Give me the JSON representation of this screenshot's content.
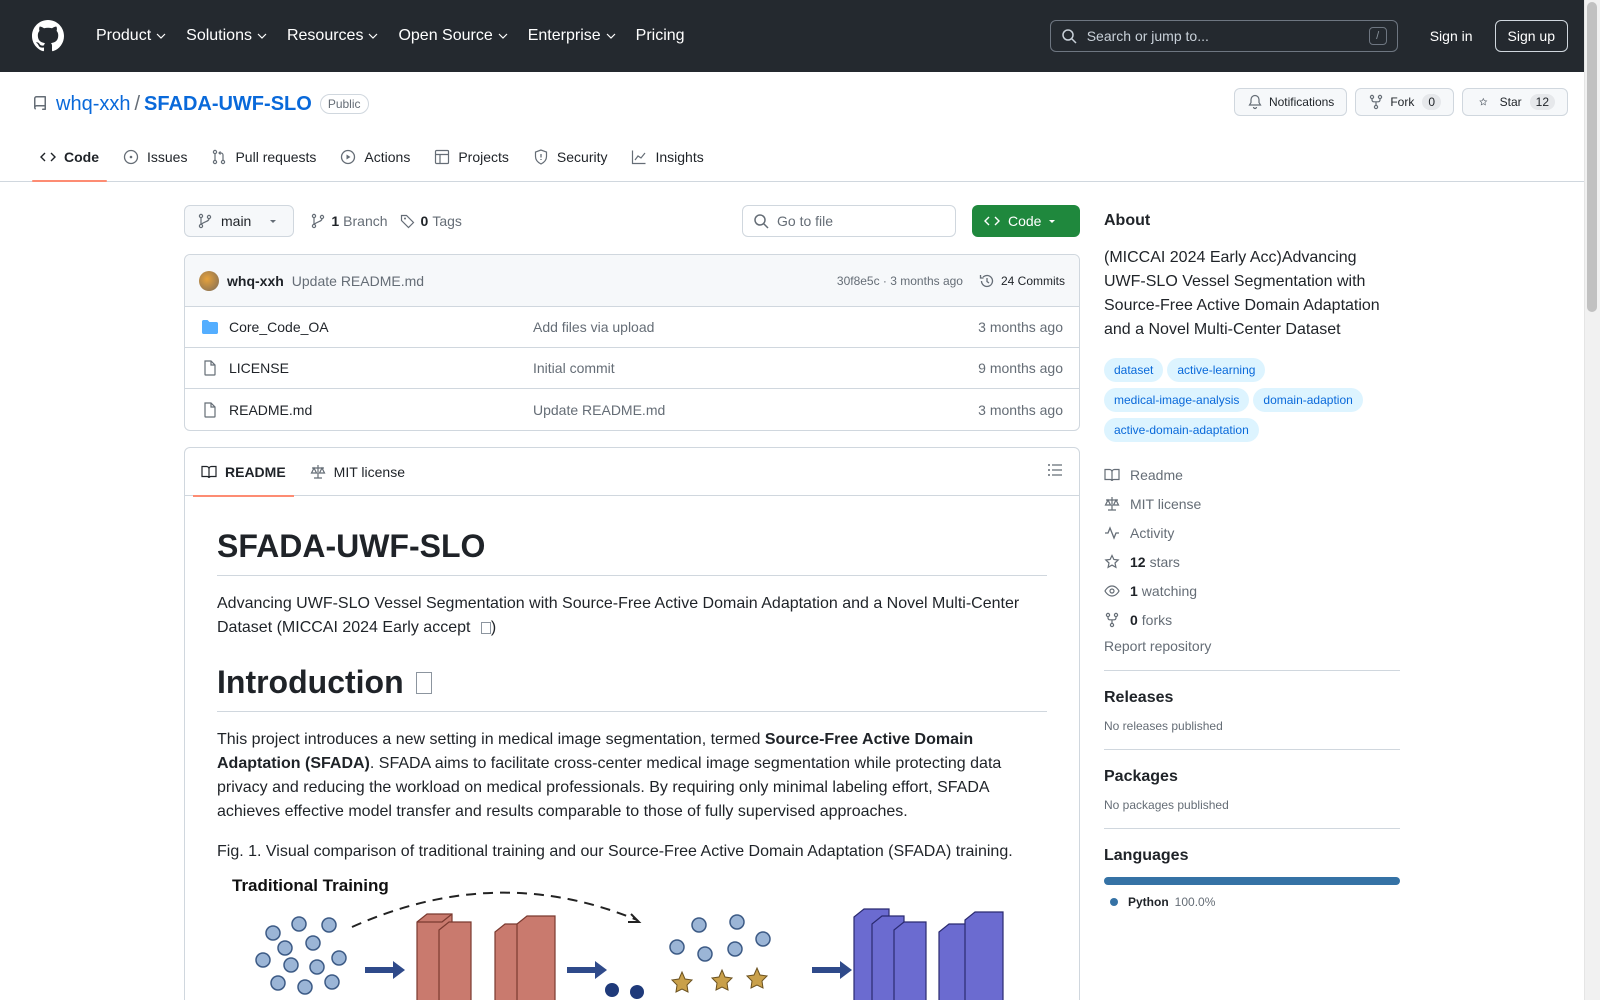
{
  "header": {
    "nav": [
      "Product",
      "Solutions",
      "Resources",
      "Open Source",
      "Enterprise",
      "Pricing"
    ],
    "search_placeholder": "Search or jump to...",
    "search_shortcut": "/",
    "sign_in": "Sign in",
    "sign_up": "Sign up"
  },
  "repo": {
    "owner": "whq-xxh",
    "separator": "/",
    "name": "SFADA-UWF-SLO",
    "visibility": "Public",
    "notifications_label": "Notifications",
    "fork_label": "Fork",
    "fork_count": "0",
    "star_label": "Star",
    "star_count": "12",
    "tabs": [
      "Code",
      "Issues",
      "Pull requests",
      "Actions",
      "Projects",
      "Security",
      "Insights"
    ]
  },
  "toolbar": {
    "branch": "main",
    "branch_count": "1",
    "branch_label": "Branch",
    "tag_count": "0",
    "tag_label": "Tags",
    "goto_placeholder": "Go to file",
    "code_button": "Code"
  },
  "commit": {
    "author": "whq-xxh",
    "message": "Update README.md",
    "hash_time": "30f8e5c · 3 months ago",
    "commits_label": "24 Commits"
  },
  "files": [
    {
      "name": "Core_Code_OA",
      "type": "folder",
      "message": "Add files via upload",
      "date": "3 months ago"
    },
    {
      "name": "LICENSE",
      "type": "file",
      "message": "Initial commit",
      "date": "9 months ago"
    },
    {
      "name": "README.md",
      "type": "file",
      "message": "Update README.md",
      "date": "3 months ago"
    }
  ],
  "readme": {
    "tab_readme": "README",
    "tab_license": "MIT license",
    "title": "SFADA-UWF-SLO",
    "subtitle": "Advancing UWF-SLO Vessel Segmentation with Source-Free Active Domain Adaptation and a Novel Multi-Center Dataset (MICCAI 2024 Early accept",
    "subtitle_end": ")",
    "intro_heading": "Introduction",
    "intro_p1": "This project introduces a new setting in medical image segmentation, termed ",
    "intro_bold": "Source-Free Active Domain Adaptation (SFADA)",
    "intro_p2": ". SFADA aims to facilitate cross-center medical image segmentation while protecting data privacy and reducing the workload on medical professionals. By requiring only minimal labeling effort, SFADA achieves effective model transfer and results comparable to those of fully supervised approaches.",
    "fig_caption": "Fig. 1. Visual comparison of traditional training and our Source-Free Active Domain Adaptation (SFADA) training.",
    "fig_label": "Traditional Training"
  },
  "about": {
    "title": "About",
    "description": "(MICCAI 2024 Early Acc)Advancing UWF-SLO Vessel Segmentation with Source-Free Active Domain Adaptation and a Novel Multi-Center Dataset",
    "topics": [
      "dataset",
      "active-learning",
      "medical-image-analysis",
      "domain-adaption",
      "active-domain-adaptation"
    ],
    "readme": "Readme",
    "license": "MIT license",
    "activity": "Activity",
    "stars_count": "12",
    "stars_label": "stars",
    "watching_count": "1",
    "watching_label": "watching",
    "forks_count": "0",
    "forks_label": "forks",
    "report": "Report repository"
  },
  "releases": {
    "title": "Releases",
    "sub": "No releases published"
  },
  "packages": {
    "title": "Packages",
    "sub": "No packages published"
  },
  "languages": {
    "title": "Languages",
    "items": [
      {
        "name": "Python",
        "percent": "100.0%",
        "color": "#3572A5"
      }
    ]
  }
}
